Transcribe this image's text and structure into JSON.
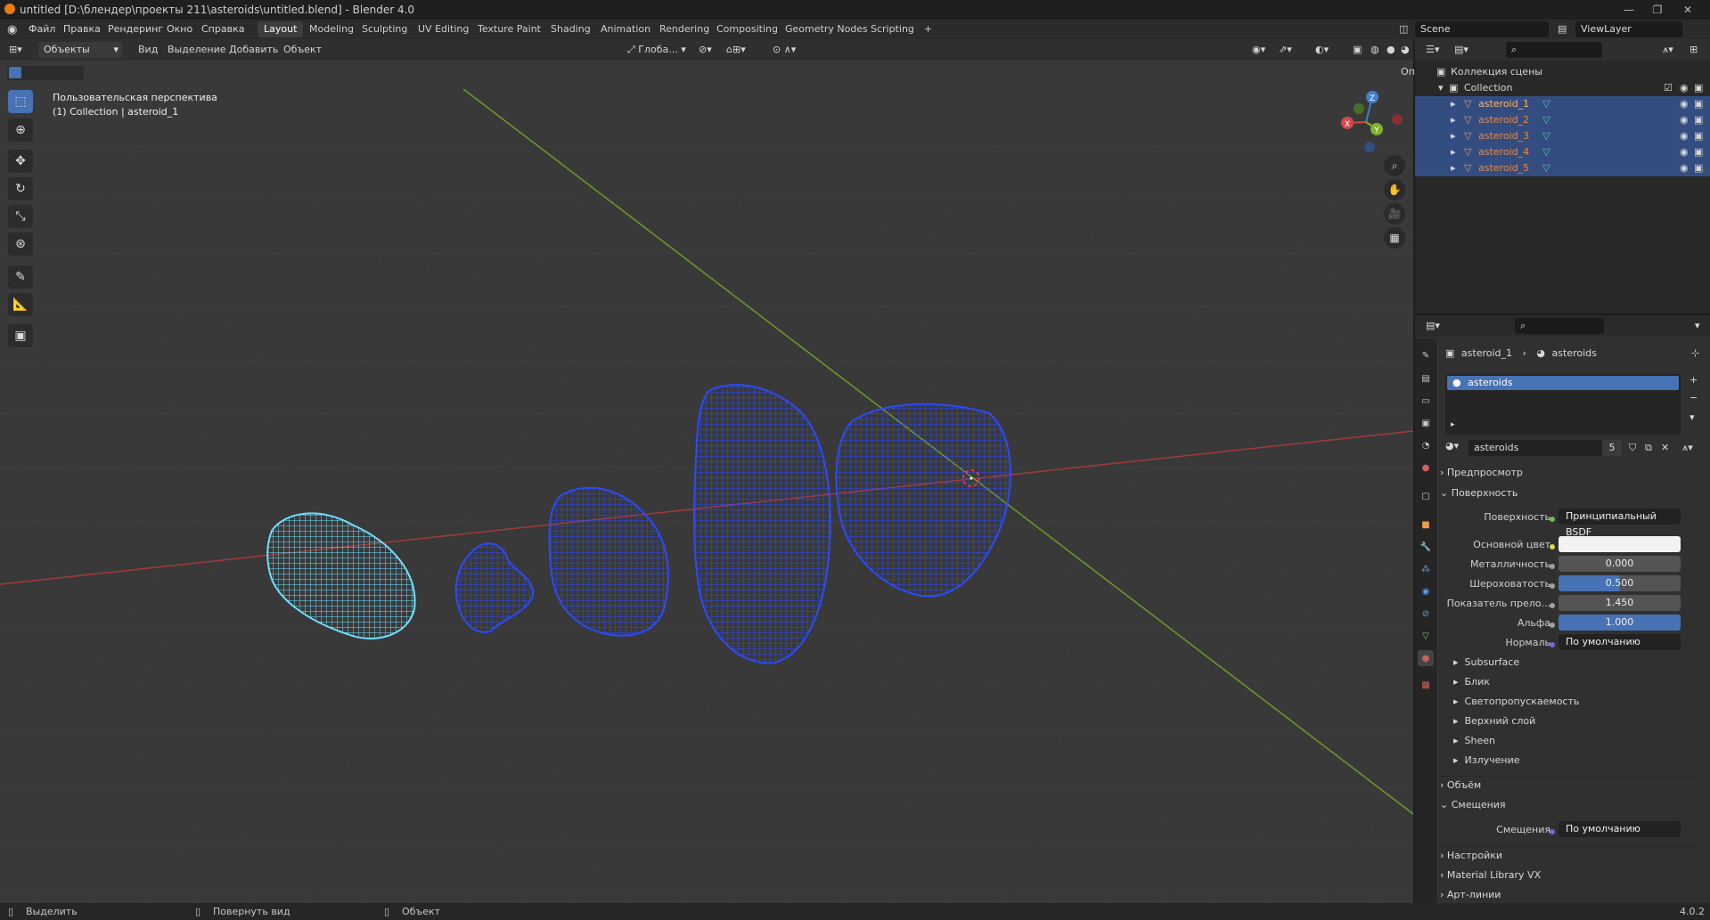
{
  "window": {
    "title": "untitled [D:\\блендер\\проекты 211\\asteroids\\untitled.blend] - Blender 4.0"
  },
  "menu": [
    "Файл",
    "Правка",
    "Рендеринг",
    "Окно",
    "Справка"
  ],
  "workspaces": [
    "Layout",
    "Modeling",
    "Sculpting",
    "UV Editing",
    "Texture Paint",
    "Shading",
    "Animation",
    "Rendering",
    "Compositing",
    "Geometry Nodes",
    "Scripting",
    "+"
  ],
  "scene": {
    "label": "Scene",
    "view_layer": "ViewLayer"
  },
  "viewport": {
    "mode": "Объекты",
    "menu": [
      "Вид",
      "Выделение",
      "Добавить",
      "Объект"
    ],
    "transform_orientation": "Глоба...",
    "options": "Опции",
    "overlay_line1": "Пользовательская перспектива",
    "overlay_line2": "(1) Collection | asteroid_1",
    "gizmo": {
      "x": "X",
      "y": "Y",
      "z": "Z"
    }
  },
  "outliner": {
    "root": "Коллекция сцены",
    "collection": "Collection",
    "objects": [
      "asteroid_1",
      "asteroid_2",
      "asteroid_3",
      "asteroid_4",
      "asteroid_5"
    ]
  },
  "properties": {
    "breadcrumb_object": "asteroid_1",
    "breadcrumb_material": "asteroids",
    "slot": "asteroids",
    "material_name": "asteroids",
    "material_users": "5",
    "sections": {
      "preview": "Предпросмотр",
      "surface_header": "Поверхность",
      "volume": "Объём",
      "displacement_header": "Смещения",
      "settings": "Настройки",
      "matlib": "Material Library VX",
      "lineart": "Арт-линии"
    },
    "surface_label": "Поверхность",
    "surface_value": "Принципиальный BSDF",
    "fields": [
      {
        "label": "Основной цвет",
        "value": ""
      },
      {
        "label": "Металличность",
        "value": "0.000"
      },
      {
        "label": "Шероховатость",
        "value": "0.500"
      },
      {
        "label": "Показатель прело...",
        "value": "1.450"
      },
      {
        "label": "Альфа",
        "value": "1.000"
      },
      {
        "label": "Нормаль",
        "value": "По умолчанию"
      }
    ],
    "subpanels": [
      "Subsurface",
      "Блик",
      "Светопропускаемость",
      "Верхний слой",
      "Sheen",
      "Излучение"
    ],
    "displacement_label": "Смещения",
    "displacement_value": "По умолчанию"
  },
  "statusbar": {
    "select": "Выделить",
    "rotate": "Повернуть вид",
    "object": "Объект",
    "version": "4.0.2"
  },
  "colors": {
    "accent": "#4772b3",
    "selected_row": "#334d80",
    "mesh_selected": "#1f3fff",
    "mesh_active": "#5ad7ff",
    "x_axis": "#a33a3a",
    "y_axis": "#6f9a2a"
  }
}
